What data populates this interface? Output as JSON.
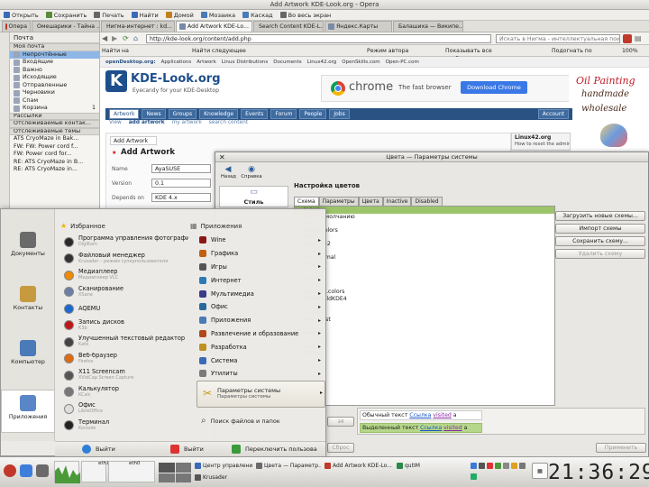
{
  "window_title": "Add Artwork KDE-Look.org - Opera",
  "menubar": [
    "Открыть",
    "Сохранить",
    "Печать",
    "Найти",
    "Домой",
    "Мозаика",
    "Каскад",
    "Во весь экран"
  ],
  "tabs": [
    {
      "label": "Опера",
      "active": false
    },
    {
      "label": "Омешарики - Тайна ...",
      "active": false
    },
    {
      "label": "Нигма-интернет : kd...",
      "active": false
    },
    {
      "label": "Add Artwork KDE-Lo...",
      "active": true
    },
    {
      "label": "Search Content KDE-L...",
      "active": false
    },
    {
      "label": "Яндекс.Карты",
      "active": false
    },
    {
      "label": "Балашиха — Википе...",
      "active": false
    }
  ],
  "mail": {
    "title": "Почта",
    "my_mail": "Моя почта",
    "folders": [
      {
        "label": "Непрочтённые",
        "selected": true
      },
      {
        "label": "Входящие",
        "selected": false
      },
      {
        "label": "Важно",
        "selected": false
      },
      {
        "label": "Исходящие",
        "selected": false
      },
      {
        "label": "Отправленные",
        "selected": false
      },
      {
        "label": "Черновики",
        "selected": false
      },
      {
        "label": "Спам",
        "selected": false
      },
      {
        "label": "Корзина",
        "count": "1",
        "selected": false
      }
    ],
    "sections": [
      "Рассылки",
      "Отслеживаемые контак...",
      "Отслеживаемые темы"
    ],
    "threads": [
      "ATS CryoMaze in Bak...",
      "FW: FW: Power cord f...",
      "FW: Power cord for...",
      "RE: ATS CryoMaze in B...",
      "RE: ATS CryoMaze in..."
    ]
  },
  "address": {
    "url": "http://kde-look.org/content/add.php",
    "search_placeholder": "Искать в Нигма - интеллектуальная поисков",
    "nav_find": "Найти на странице",
    "nav_next": "Найти следующее",
    "mode": "Режим автора",
    "show_images": "Показывать все изображения",
    "fit": "Подогнать по ширине",
    "zoom": "100%"
  },
  "web": {
    "topnav": [
      "openDesktop.org:",
      "Applications",
      "Artwork",
      "Linux Distributions",
      "Documents",
      "Linux42.org",
      "OpenSkills.com",
      "Open-PC.com"
    ],
    "site_title": "KDE-Look.org",
    "site_sub": "Eyecandy for your KDE-Desktop",
    "ad_brand": "chrome",
    "ad_text": "The fast browser",
    "ad_button": "Download Chrome",
    "side_ad": [
      "Oil Painting",
      "handmade",
      "wholesale"
    ],
    "nav": [
      "Artwork",
      "News",
      "Groups",
      "Knowledge",
      "Events",
      "Forum",
      "People",
      "Jobs",
      "Account"
    ],
    "subnav": [
      "View",
      "add artwork",
      "my artwork",
      "search content"
    ],
    "form_tab": "Add Artwork",
    "form_heading": "Add Artwork",
    "fields": [
      {
        "label": "Name",
        "value": "AyaSUSE"
      },
      {
        "label": "Version",
        "value": "0.1"
      },
      {
        "label": "Depends on",
        "value": "KDE 4.x"
      }
    ],
    "linux42_title": "Linux42.org",
    "linux42_link": "How to reset the admin"
  },
  "dialog": {
    "title": "Цвета — Параметры системы",
    "back": "Назад",
    "help": "Справка",
    "left_label": "Стиль",
    "heading": "Настройка цветов",
    "tabs": [
      "Схема",
      "Параметры",
      "Цвета",
      "Inactive",
      "Disabled"
    ],
    "schemes": [
      "...схема",
      "...ию по умолчанию",
      "...ess",
      "...bunny.colors",
      "...ance",
      "...rayon_0-2",
      "",
      "...lack-normal",
      "...Frost",
      "",
      "...Colors",
      "",
      "...nDust25.colors",
      "...rkRedGoldKDE4",
      "",
      "...nt_new",
      "...reen Frost",
      "...a",
      "...baks",
      "",
      "...Eyes",
      "...hoctans",
      "",
      "...e"
    ],
    "buttons": [
      "Загрузить новые схемы...",
      "Импорт схемы",
      "Сохранить схему...",
      "Удалить схему"
    ],
    "preview_normal": "Обычный текст",
    "preview_link": "Ссылка",
    "preview_visited": "visited",
    "preview_selected": "Выделенный текст",
    "reset": "Сброс",
    "apply": "Применить",
    "left_fragment": "эя"
  },
  "kmenu": {
    "places": [
      "Документы",
      "Контакты",
      "Компьютер",
      "Приложения"
    ],
    "favorites_header": "Избранное",
    "apps_header": "Приложения",
    "favorites": [
      {
        "name": "Программа управления фотографиями",
        "desc": "DigiKam",
        "color": "#2a2a2a"
      },
      {
        "name": "Файловый менеджер",
        "desc": "Krusader – режим суперпользователя",
        "color": "#333"
      },
      {
        "name": "Медиаплеер",
        "desc": "Медиаплеер VLC",
        "color": "#f08a00"
      },
      {
        "name": "Сканирование",
        "desc": "XSane",
        "color": "#6a7ea8"
      },
      {
        "name": "AQEMU",
        "desc": "",
        "color": "#1c6ad0"
      },
      {
        "name": "Запись дисков",
        "desc": "K3b",
        "color": "#c01818"
      },
      {
        "name": "Улучшенный текстовый редактор",
        "desc": "Kate",
        "color": "#444"
      },
      {
        "name": "Веб-браузер",
        "desc": "Firefox",
        "color": "#e06a10"
      },
      {
        "name": "X11 Screencam",
        "desc": "XVidCap Screen Capture",
        "color": "#555"
      },
      {
        "name": "Калькулятор",
        "desc": "KCalc",
        "color": "#777"
      },
      {
        "name": "Офис",
        "desc": "LibreOffice",
        "color": "#ddd"
      },
      {
        "name": "Терминал",
        "desc": "Konsole",
        "color": "#222"
      }
    ],
    "apps": [
      "Wine",
      "Графика",
      "Игры",
      "Интернет",
      "Мультимедиа",
      "Офис",
      "Приложения",
      "Развлечение и образование",
      "Разработка",
      "Система",
      "Утилиты"
    ],
    "highlight_title": "Параметры системы",
    "highlight_sub": "Параметры системы",
    "search": "Поиск файлов и папок",
    "logout1": "Выйти",
    "logout2": "Выйти",
    "switch_user": "Переключить пользова"
  },
  "panel": {
    "net1": "eth1",
    "net2": "eth0",
    "tasks": [
      "Центр управлени...",
      "Цвета — Параметр...",
      "Add Artwork KDE-Lo...",
      "qutIM",
      "Krusader"
    ],
    "clock": "21:36:29"
  }
}
